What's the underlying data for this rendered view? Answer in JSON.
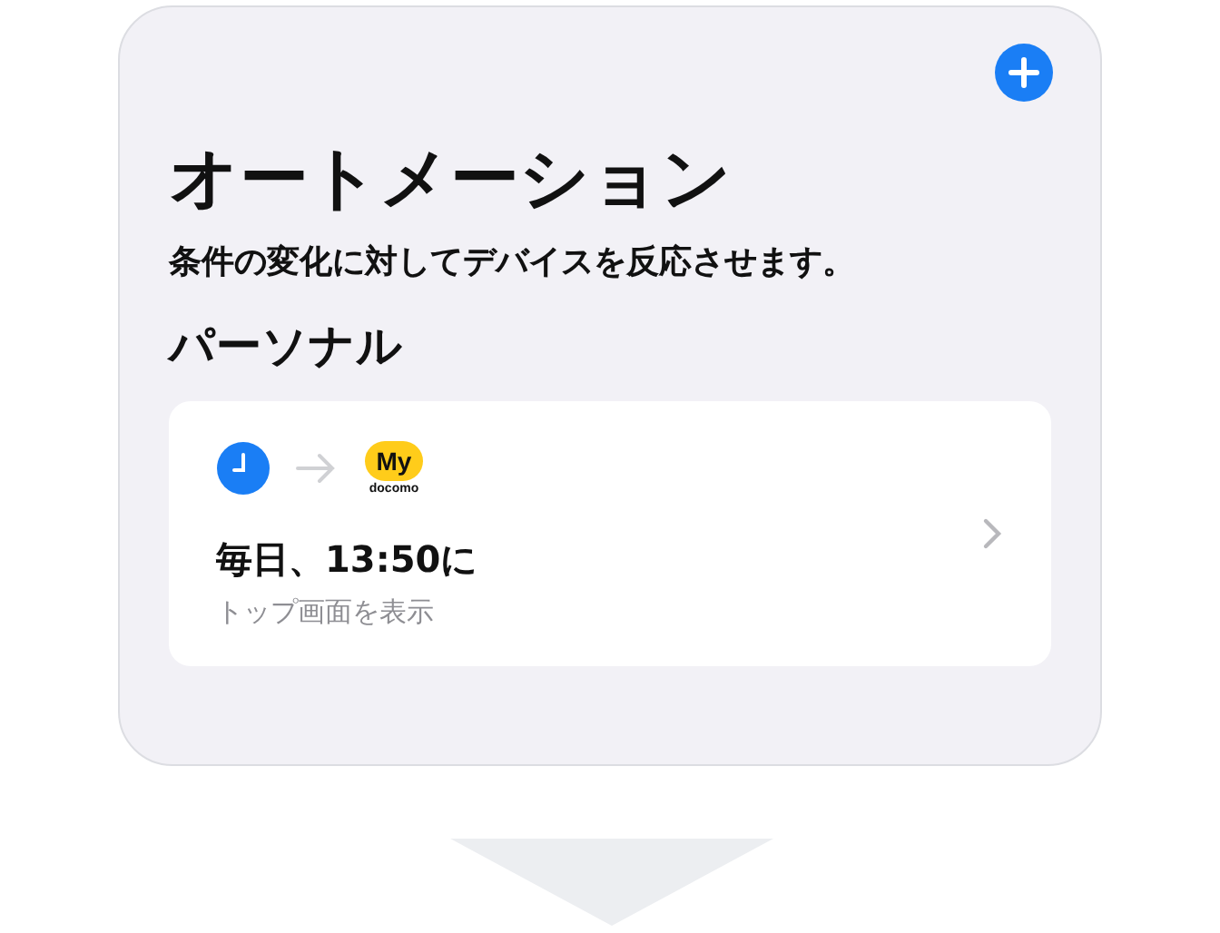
{
  "screen": {
    "title": "オートメーション",
    "subtitle": "条件の変化に対してデバイスを反応させます。"
  },
  "section": {
    "title": "パーソナル"
  },
  "automations": [
    {
      "app_label": "My",
      "app_sublabel": "docomo",
      "title": "毎日、13:50に",
      "detail": "トップ画面を表示"
    }
  ]
}
